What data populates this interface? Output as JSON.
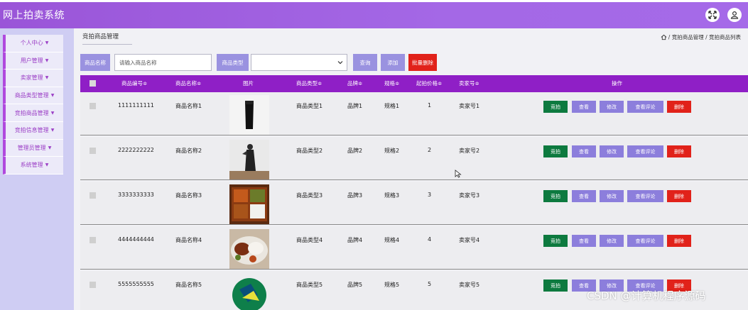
{
  "app": {
    "title": "网上拍卖系统"
  },
  "sidebar": {
    "items": [
      {
        "label": "个人中心"
      },
      {
        "label": "用户管理"
      },
      {
        "label": "卖家管理"
      },
      {
        "label": "商品类型管理"
      },
      {
        "label": "竞拍商品管理"
      },
      {
        "label": "竞拍信息管理"
      },
      {
        "label": "管理员管理"
      },
      {
        "label": "系统管理"
      }
    ]
  },
  "breadcrumb": {
    "page_title": "竞拍商品管理",
    "trail": "/ 竞拍商品管理 / 竞拍商品列表"
  },
  "search": {
    "name_label": "商品名称",
    "name_placeholder": "请输入商品名称",
    "type_label": "商品类型",
    "type_value": "",
    "query_button": "查询",
    "add_button": "添加",
    "batch_delete_button": "批量删除"
  },
  "table": {
    "columns": [
      "商品编号≑",
      "商品名称≑",
      "图片",
      "商品类型≑",
      "品牌≑",
      "规格≑",
      "起拍价格≑",
      "卖家号≑",
      "操作"
    ],
    "rows": [
      {
        "id": "1111111111",
        "name": "商品名称1",
        "type": "商品类型1",
        "brand": "品牌1",
        "spec": "规格1",
        "price": "1",
        "seller": "卖家号1"
      },
      {
        "id": "2222222222",
        "name": "商品名称2",
        "type": "商品类型2",
        "brand": "品牌2",
        "spec": "规格2",
        "price": "2",
        "seller": "卖家号2"
      },
      {
        "id": "3333333333",
        "name": "商品名称3",
        "type": "商品类型3",
        "brand": "品牌3",
        "spec": "规格3",
        "price": "3",
        "seller": "卖家号3"
      },
      {
        "id": "4444444444",
        "name": "商品名称4",
        "type": "商品类型4",
        "brand": "品牌4",
        "spec": "规格4",
        "price": "4",
        "seller": "卖家号4"
      },
      {
        "id": "5555555555",
        "name": "商品名称5",
        "type": "商品类型5",
        "brand": "品牌5",
        "spec": "规格5",
        "price": "5",
        "seller": "卖家号5"
      }
    ],
    "actions": {
      "bid": "竞拍",
      "view": "查看",
      "edit": "修改",
      "review": "查看评论",
      "delete": "删除"
    }
  },
  "watermark": "CSDN @计算机程序源码",
  "colors": {
    "header": "#a165e4",
    "table_header": "#8f1fc6",
    "bid": "#0d7a3f",
    "action": "#8c7edc",
    "delete": "#e1221a",
    "sidebar_accent": "#b049de"
  },
  "icons": {
    "fullscreen": "fullscreen-icon",
    "user": "user-icon",
    "home": "home-icon",
    "caret": "caret-down-icon"
  }
}
